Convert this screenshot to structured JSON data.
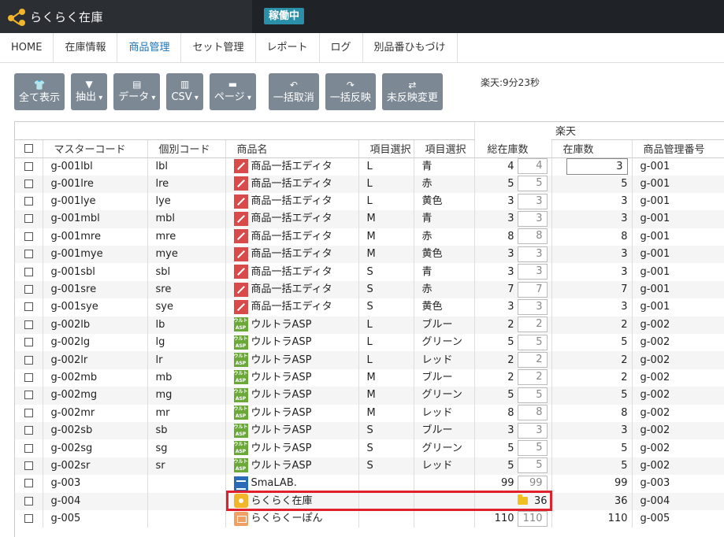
{
  "app": {
    "name": "らくらく在庫",
    "status": "稼働中"
  },
  "nav": [
    "HOME",
    "在庫情報",
    "商品管理",
    "セット管理",
    "レポート",
    "ログ",
    "別品番ひもづけ"
  ],
  "nav_active": "商品管理",
  "toolbar": [
    {
      "label": "全て表示",
      "icon": "shirt-icon",
      "caret": false
    },
    {
      "label": "抽出",
      "icon": "filter-icon",
      "caret": true
    },
    {
      "label": "データ",
      "icon": "file-icon",
      "caret": true
    },
    {
      "label": "CSV",
      "icon": "csv-file-icon",
      "caret": true
    },
    {
      "label": "ページ",
      "icon": "store-icon",
      "caret": true
    },
    {
      "label": "一括取消",
      "icon": "undo-icon",
      "caret": false
    },
    {
      "label": "一括反映",
      "icon": "redo-icon",
      "caret": false
    },
    {
      "label": "未反映変更",
      "icon": "swap-icon",
      "caret": false
    }
  ],
  "timer": "楽天:9分23秒",
  "table": {
    "group_header": "楽天",
    "columns": [
      "マスターコード",
      "個別コード",
      "商品名",
      "項目選択",
      "項目選択",
      "総在庫数",
      "在庫数",
      "商品管理番号"
    ],
    "rows": [
      {
        "master": "g-001lbl",
        "code": "lbl",
        "icon": "edit",
        "name": "商品一括エディタ",
        "opt1": "L",
        "opt2": "青",
        "total": "4",
        "box": "4",
        "stock": "3",
        "mgmt": "g-001"
      },
      {
        "master": "g-001lre",
        "code": "lre",
        "icon": "edit",
        "name": "商品一括エディタ",
        "opt1": "L",
        "opt2": "赤",
        "total": "5",
        "box": "5",
        "stock": "5",
        "mgmt": "g-001"
      },
      {
        "master": "g-001lye",
        "code": "lye",
        "icon": "edit",
        "name": "商品一括エディタ",
        "opt1": "L",
        "opt2": "黄色",
        "total": "3",
        "box": "3",
        "stock": "3",
        "mgmt": "g-001"
      },
      {
        "master": "g-001mbl",
        "code": "mbl",
        "icon": "edit",
        "name": "商品一括エディタ",
        "opt1": "M",
        "opt2": "青",
        "total": "3",
        "box": "3",
        "stock": "3",
        "mgmt": "g-001"
      },
      {
        "master": "g-001mre",
        "code": "mre",
        "icon": "edit",
        "name": "商品一括エディタ",
        "opt1": "M",
        "opt2": "赤",
        "total": "8",
        "box": "8",
        "stock": "8",
        "mgmt": "g-001"
      },
      {
        "master": "g-001mye",
        "code": "mye",
        "icon": "edit",
        "name": "商品一括エディタ",
        "opt1": "M",
        "opt2": "黄色",
        "total": "3",
        "box": "3",
        "stock": "3",
        "mgmt": "g-001"
      },
      {
        "master": "g-001sbl",
        "code": "sbl",
        "icon": "edit",
        "name": "商品一括エディタ",
        "opt1": "S",
        "opt2": "青",
        "total": "3",
        "box": "3",
        "stock": "3",
        "mgmt": "g-001"
      },
      {
        "master": "g-001sre",
        "code": "sre",
        "icon": "edit",
        "name": "商品一括エディタ",
        "opt1": "S",
        "opt2": "赤",
        "total": "7",
        "box": "7",
        "stock": "7",
        "mgmt": "g-001"
      },
      {
        "master": "g-001sye",
        "code": "sye",
        "icon": "edit",
        "name": "商品一括エディタ",
        "opt1": "S",
        "opt2": "黄色",
        "total": "3",
        "box": "3",
        "stock": "3",
        "mgmt": "g-001"
      },
      {
        "master": "g-002lb",
        "code": "lb",
        "icon": "ultra",
        "name": "ウルトラASP",
        "opt1": "L",
        "opt2": "ブルー",
        "total": "2",
        "box": "2",
        "stock": "2",
        "mgmt": "g-002"
      },
      {
        "master": "g-002lg",
        "code": "lg",
        "icon": "ultra",
        "name": "ウルトラASP",
        "opt1": "L",
        "opt2": "グリーン",
        "total": "5",
        "box": "5",
        "stock": "5",
        "mgmt": "g-002"
      },
      {
        "master": "g-002lr",
        "code": "lr",
        "icon": "ultra",
        "name": "ウルトラASP",
        "opt1": "L",
        "opt2": "レッド",
        "total": "2",
        "box": "2",
        "stock": "2",
        "mgmt": "g-002"
      },
      {
        "master": "g-002mb",
        "code": "mb",
        "icon": "ultra",
        "name": "ウルトラASP",
        "opt1": "M",
        "opt2": "ブルー",
        "total": "2",
        "box": "2",
        "stock": "2",
        "mgmt": "g-002"
      },
      {
        "master": "g-002mg",
        "code": "mg",
        "icon": "ultra",
        "name": "ウルトラASP",
        "opt1": "M",
        "opt2": "グリーン",
        "total": "5",
        "box": "5",
        "stock": "5",
        "mgmt": "g-002"
      },
      {
        "master": "g-002mr",
        "code": "mr",
        "icon": "ultra",
        "name": "ウルトラASP",
        "opt1": "M",
        "opt2": "レッド",
        "total": "8",
        "box": "8",
        "stock": "8",
        "mgmt": "g-002"
      },
      {
        "master": "g-002sb",
        "code": "sb",
        "icon": "ultra",
        "name": "ウルトラASP",
        "opt1": "S",
        "opt2": "ブルー",
        "total": "3",
        "box": "3",
        "stock": "3",
        "mgmt": "g-002"
      },
      {
        "master": "g-002sg",
        "code": "sg",
        "icon": "ultra",
        "name": "ウルトラASP",
        "opt1": "S",
        "opt2": "グリーン",
        "total": "5",
        "box": "5",
        "stock": "5",
        "mgmt": "g-002"
      },
      {
        "master": "g-002sr",
        "code": "sr",
        "icon": "ultra",
        "name": "ウルトラASP",
        "opt1": "S",
        "opt2": "レッド",
        "total": "5",
        "box": "5",
        "stock": "5",
        "mgmt": "g-002"
      },
      {
        "master": "g-003",
        "code": "",
        "icon": "sma",
        "name": "SmaLAB.",
        "opt1": "",
        "opt2": "",
        "total": "99",
        "box": "99",
        "stock": "99",
        "mgmt": "g-003"
      },
      {
        "master": "g-004",
        "code": "",
        "icon": "rakuraku",
        "name": "らくらく在庫",
        "opt1": "",
        "opt2": "",
        "total": "36",
        "box": "",
        "folder": true,
        "stock": "36",
        "mgmt": "g-004"
      },
      {
        "master": "g-005",
        "code": "",
        "icon": "pon",
        "name": "らくらくーぽん",
        "opt1": "",
        "opt2": "",
        "total": "110",
        "box": "110",
        "stock": "110",
        "mgmt": "g-005"
      }
    ]
  },
  "colors": {
    "topbar": "#1f2328",
    "badge": "#2a8fa8",
    "active_nav": "#1a73b8",
    "button": "#7c8894",
    "highlight": "#e0202a"
  }
}
